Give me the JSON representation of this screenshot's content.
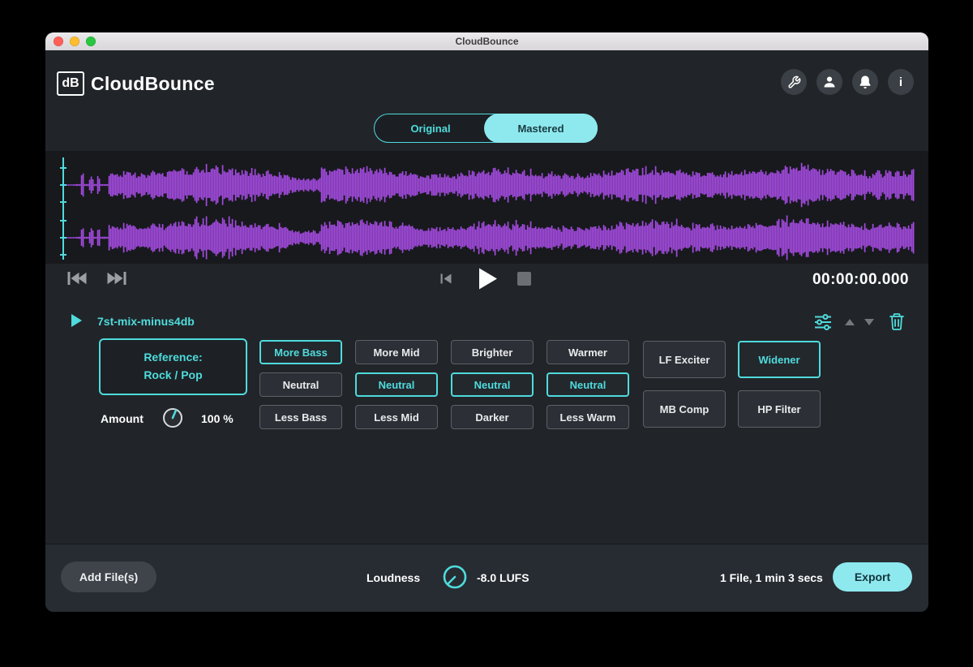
{
  "titlebar": {
    "title": "CloudBounce"
  },
  "brand": {
    "logo": "dB",
    "name": "CloudBounce"
  },
  "view_toggle": {
    "original": "Original",
    "mastered": "Mastered",
    "active": "Mastered"
  },
  "transport": {
    "time": "00:00:00.000"
  },
  "track": {
    "name": "7st-mix-minus4db"
  },
  "reference": {
    "label_line1": "Reference:",
    "label_line2": "Rock / Pop",
    "selected": true
  },
  "amount": {
    "label": "Amount",
    "value": "100 %"
  },
  "adjust": {
    "bass": [
      "More Bass",
      "Neutral",
      "Less Bass"
    ],
    "mid": [
      "More Mid",
      "Neutral",
      "Less Mid"
    ],
    "brightness": [
      "Brighter",
      "Neutral",
      "Darker"
    ],
    "warmth": [
      "Warmer",
      "Neutral",
      "Less Warm"
    ],
    "selected": {
      "bass": "More Bass",
      "mid": "Neutral",
      "brightness": "Neutral",
      "warmth": "Neutral"
    }
  },
  "effects": {
    "lf_exciter": "LF Exciter",
    "widener": "Widener",
    "mb_comp": "MB Comp",
    "hp_filter": "HP Filter",
    "selected": [
      "Widener"
    ]
  },
  "footer": {
    "add_files": "Add File(s)",
    "loudness_label": "Loudness",
    "loudness_value": "-8.0 LUFS",
    "file_summary": "1 File, 1 min 3 secs",
    "export": "Export"
  },
  "icons": {
    "info_glyph": "i",
    "header": [
      "wrench",
      "account",
      "bell",
      "info"
    ],
    "transport": [
      "skip-to-start",
      "skip-to-end",
      "previous",
      "play",
      "stop"
    ],
    "track_tools": [
      "sliders",
      "move-up",
      "move-down",
      "trash"
    ]
  },
  "colors": {
    "accent": "#4fdbdc",
    "accent_fill": "#8ee9ef",
    "waveform": "#a44be0"
  }
}
